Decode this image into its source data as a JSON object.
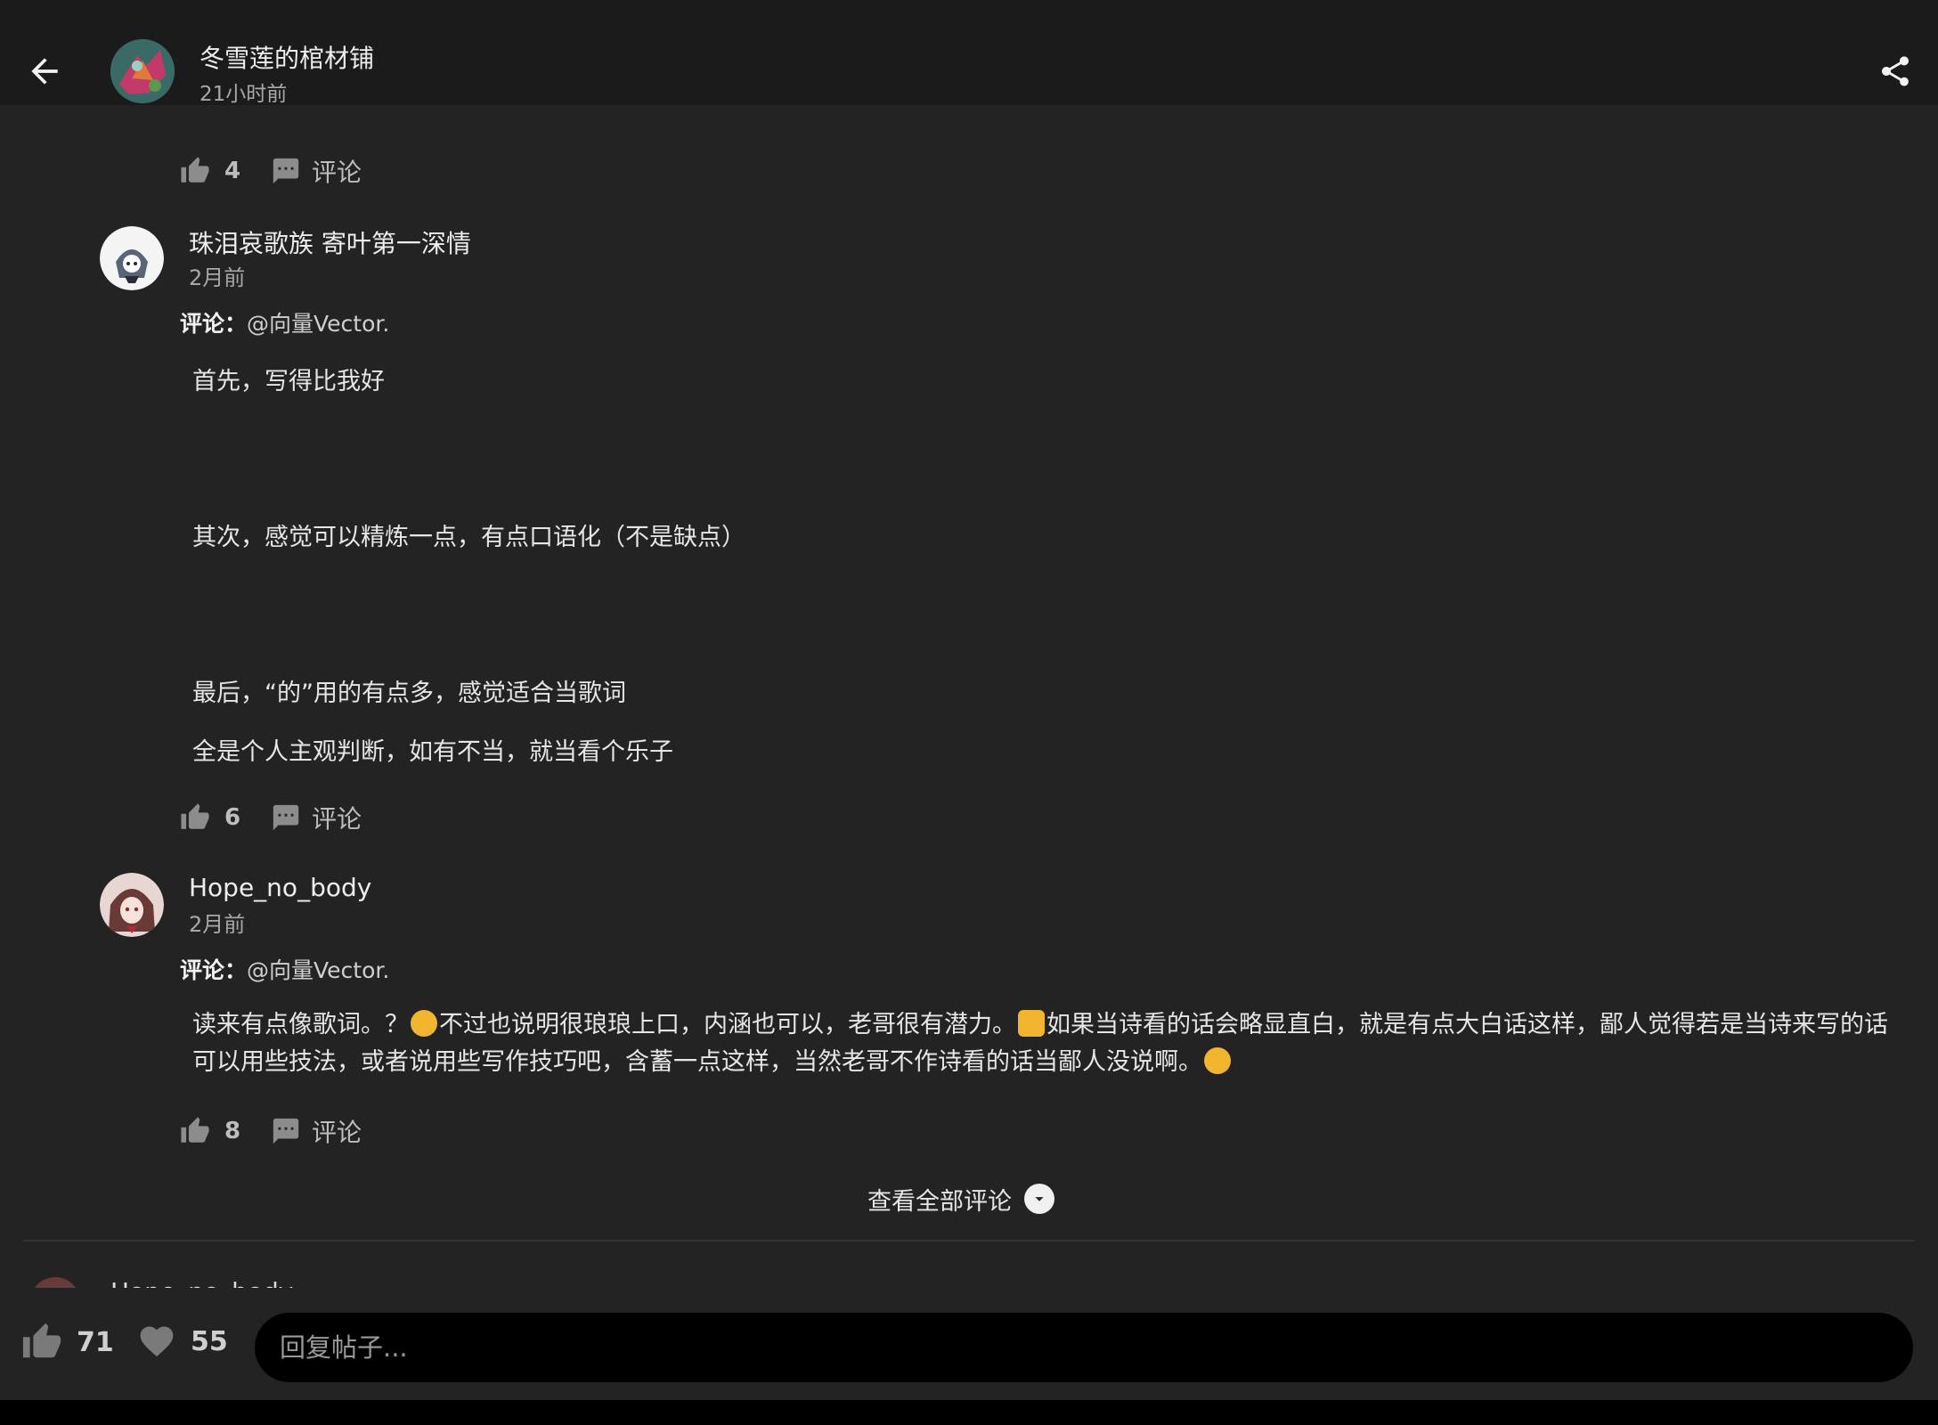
{
  "header": {
    "title": "冬雪莲的棺材铺",
    "time": "21小时前",
    "back_icon": "arrow-left-icon",
    "share_icon": "share-icon"
  },
  "top_actions": {
    "likes": "4",
    "comment_label": "评论"
  },
  "comments": [
    {
      "name": "珠泪哀歌族 寄叶第一深情",
      "time": "2月前",
      "ref_label": "评论：",
      "ref_target": "@向量Vector.",
      "lines": [
        "首先，写得比我好",
        "其次，感觉可以精炼一点，有点口语化（不是缺点）",
        "最后，“的”用的有点多，感觉适合当歌词",
        "全是个人主观判断，如有不当，就当看个乐子"
      ],
      "likes": "6",
      "comment_label": "评论"
    },
    {
      "name": "Hope_no_body",
      "time": "2月前",
      "ref_label": "评论：",
      "ref_target": "@向量Vector.",
      "text_part1": "读来有点像歌词。？",
      "text_part2": "不过也说明很琅琅上口，内涵也可以，老哥很有潜力。",
      "text_part3": "如果当诗看的话会略显直白，就是有点大白话这样，鄙人觉得若是当诗来写的话可以用些技法，或者说用些写作技巧吧，含蓄一点这样，当然老哥不作诗看的话当鄙人没说啊。",
      "likes": "8",
      "comment_label": "评论"
    }
  ],
  "view_all_label": "查看全部评论",
  "next_comment_name": "Hope_no_body",
  "bottom": {
    "likes": "71",
    "favorites": "55",
    "reply_placeholder": "回复帖子..."
  },
  "colors": {
    "background": "#232323",
    "topbar": "#1b1b1b",
    "input_bg": "#000000",
    "text": "#e6e6e6",
    "muted": "#a8a8a8"
  }
}
